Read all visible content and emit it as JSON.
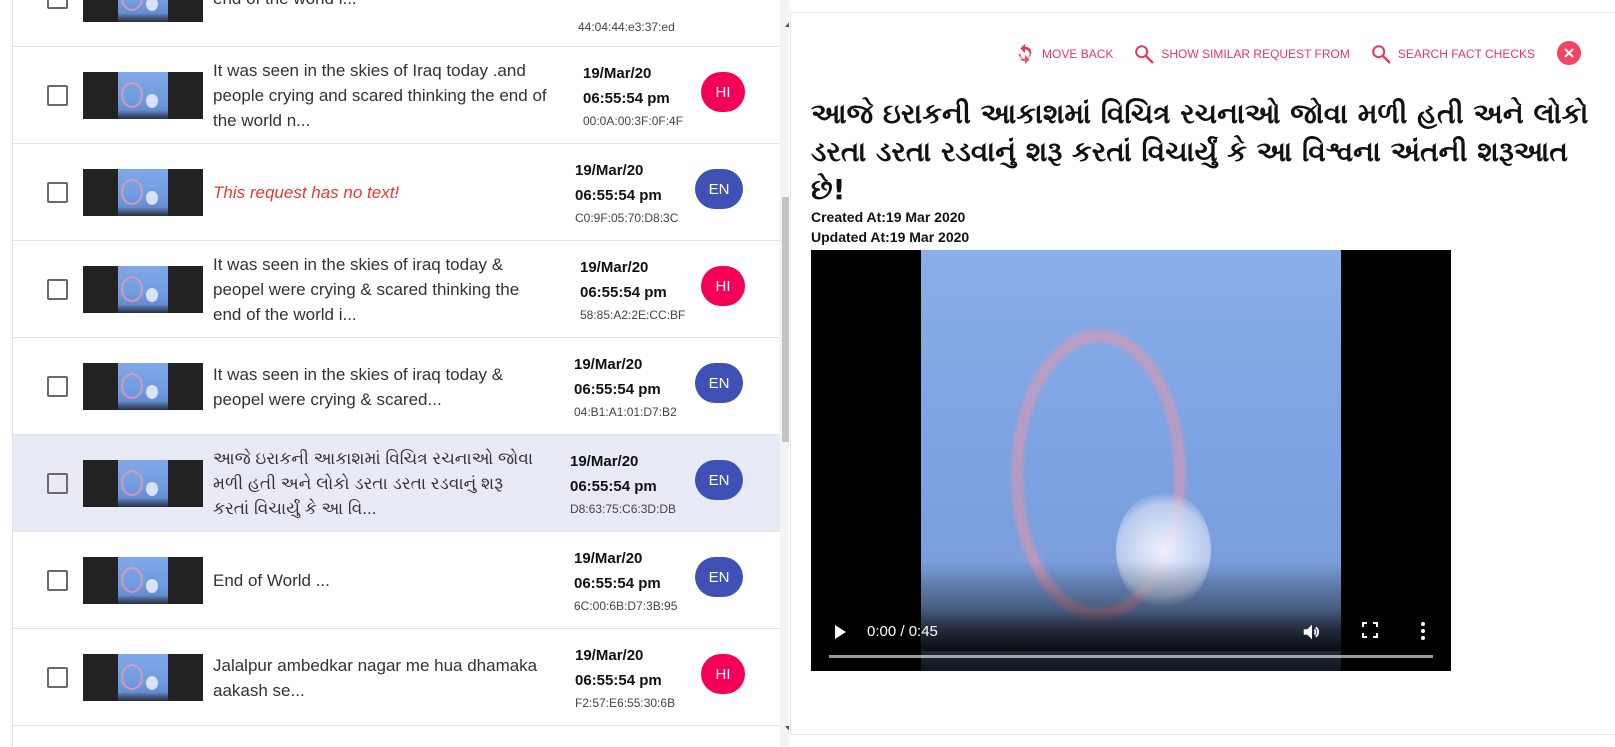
{
  "list": {
    "rows": [
      {
        "text": [
          "end of the world i..."
        ],
        "date": "",
        "time": "",
        "mac": "44:04:44:e3:37:ed",
        "lang": "",
        "langClass": "en",
        "notext": false,
        "selected": false
      },
      {
        "text": [
          "It was seen in the skies of Iraq today .and",
          "people crying and scared thinking the end of",
          "the world n..."
        ],
        "date": "19/Mar/20",
        "time": "06:55:54 pm",
        "mac": "00:0A:00:3F:0F:4F",
        "lang": "HI",
        "langClass": "hi",
        "notext": false,
        "selected": false
      },
      {
        "text": [
          "This request has no text!"
        ],
        "date": "19/Mar/20",
        "time": "06:55:54 pm",
        "mac": "C0:9F:05:70:D8:3C",
        "lang": "EN",
        "langClass": "en",
        "notext": true,
        "selected": false
      },
      {
        "text": [
          "It was seen in the skies of iraq today &",
          "peopel were crying & scared thinking the",
          "end of the world i..."
        ],
        "date": "19/Mar/20",
        "time": "06:55:54 pm",
        "mac": "58:85:A2:2E:CC:BF",
        "lang": "HI",
        "langClass": "hi",
        "notext": false,
        "selected": false
      },
      {
        "text": [
          "It was seen in the skies of iraq today &",
          "peopel were crying & scared..."
        ],
        "date": "19/Mar/20",
        "time": "06:55:54 pm",
        "mac": "04:B1:A1:01:D7:B2",
        "lang": "EN",
        "langClass": "en",
        "notext": false,
        "selected": false
      },
      {
        "text": [
          "આજે ઇરાકની આકાશમાં વિચિત્ર રચનાઓ જોવા",
          "મળી હતી અને લોકો ડરતા ડરતા રડવાનું શરૂ",
          "કરતાં વિચાર્યું કે આ વિ..."
        ],
        "date": "19/Mar/20",
        "time": "06:55:54 pm",
        "mac": "D8:63:75:C6:3D:DB",
        "lang": "EN",
        "langClass": "en",
        "notext": false,
        "selected": true
      },
      {
        "text": [
          "End of World ..."
        ],
        "date": "19/Mar/20",
        "time": "06:55:54 pm",
        "mac": "6C:00:6B:D7:3B:95",
        "lang": "EN",
        "langClass": "en",
        "notext": false,
        "selected": false
      },
      {
        "text": [
          "Jalalpur ambedkar nagar me hua dhamaka",
          "aakash se..."
        ],
        "date": "19/Mar/20",
        "time": "06:55:54 pm",
        "mac": "F2:57:E6:55:30:6B",
        "lang": "HI",
        "langClass": "hi",
        "notext": false,
        "selected": false
      }
    ]
  },
  "toolbar": {
    "move_back": "MOVE BACK",
    "show_similar": "SHOW SIMILAR REQUEST FROM",
    "search_fact_checks": "SEARCH FACT CHECKS"
  },
  "detail": {
    "headline": "આજે ઇરાકની આકાશમાં વિચિત્ર રચનાઓ જોવા મળી હતી અને લોકો ડરતા ડરતા રડવાનું શરૂ કરતાં વિચાર્યું કે આ વિશ્વના અંતની શરૂઆત છે!",
    "created": "Created At:19 Mar 2020",
    "updated": "Updated At:19 Mar 2020"
  },
  "video": {
    "timecode": "0:00 / 0:45",
    "progress": 0.0
  },
  "colors": {
    "accent": "#e53958",
    "hi_badge": "#f50057",
    "en_badge": "#3f51b5",
    "selected_row": "#e8eaf6",
    "notext": "#e53935"
  }
}
